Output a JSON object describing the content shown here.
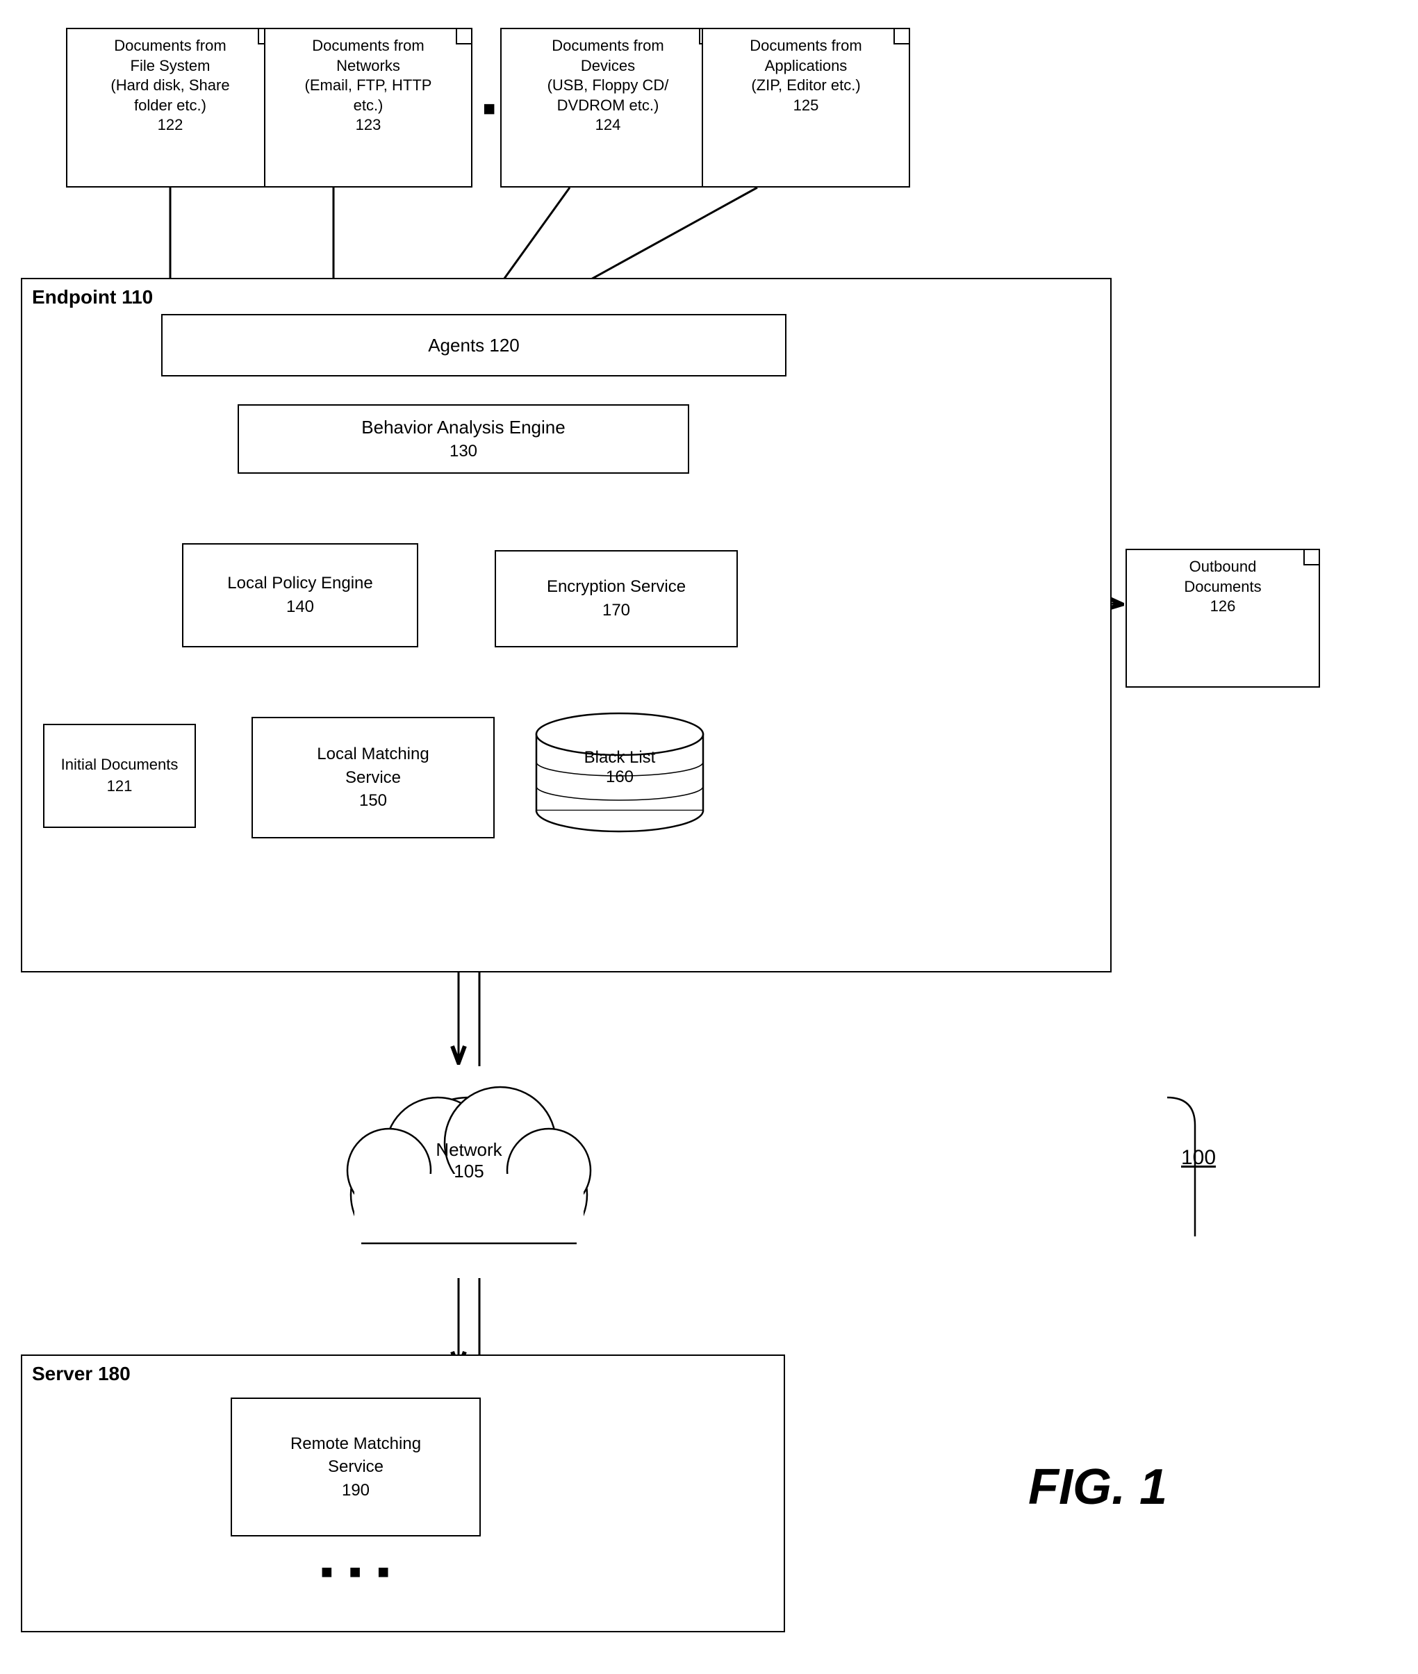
{
  "title": "FIG. 1",
  "system_number": "100",
  "endpoint": {
    "label": "Endpoint 110"
  },
  "server": {
    "label": "Server 180"
  },
  "network": {
    "label": "Network",
    "number": "105"
  },
  "agents": {
    "label": "Agents 120"
  },
  "behavior_analysis": {
    "label": "Behavior Analysis Engine",
    "number": "130"
  },
  "local_policy": {
    "label": "Local Policy Engine",
    "number": "140"
  },
  "encryption": {
    "label": "Encryption Service",
    "number": "170"
  },
  "local_matching": {
    "label": "Local Matching\nService",
    "number": "150"
  },
  "blacklist": {
    "label": "Black List",
    "number": "160"
  },
  "initial_docs": {
    "label": "Initial Documents",
    "number": "121"
  },
  "outbound_docs": {
    "label": "Outbound\nDocuments",
    "number": "126"
  },
  "remote_matching": {
    "label": "Remote Matching\nService",
    "number": "190"
  },
  "doc_sources": [
    {
      "label": "Documents from\nFile System\n(Hard disk, Share\nfolder etc.)",
      "number": "122"
    },
    {
      "label": "Documents from\nNetworks\n(Email, FTP, HTTP\netc.)",
      "number": "123"
    },
    {
      "label": "Documents from\nDevices\n(USB, Floppy CD/\nDVDROM etc.)",
      "number": "124"
    },
    {
      "label": "Documents from\nApplications\n(ZIP, Editor etc.)",
      "number": "125"
    }
  ]
}
